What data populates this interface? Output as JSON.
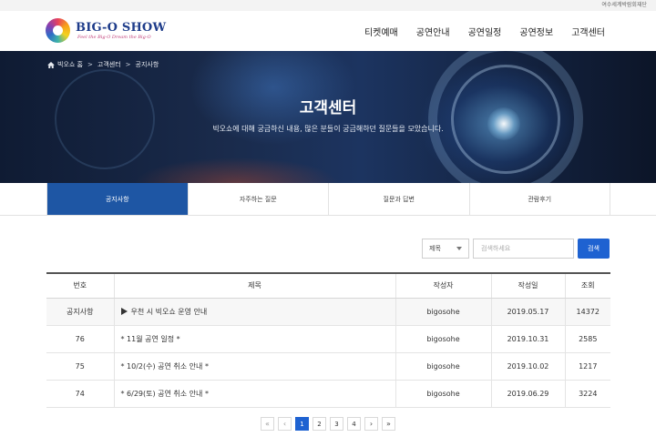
{
  "topbar": {
    "org": "여수세계박람회재단"
  },
  "logo": {
    "title": "BIG-O SHOW",
    "subtitle": "Feel the Big-O  Dream the Big-O"
  },
  "nav": {
    "items": [
      "티켓예매",
      "공연안내",
      "공연일정",
      "공연정보",
      "고객센터"
    ]
  },
  "breadcrumb": {
    "home": "빅오쇼 홈",
    "level1": "고객센터",
    "level2": "공지사항",
    "sep": ">"
  },
  "hero": {
    "title": "고객센터",
    "description": "빅오쇼에 대해 궁금하신 내용, 많은 분들이 궁금해하던 질문들을 모았습니다."
  },
  "tabs": [
    {
      "label": "공지사항",
      "active": true
    },
    {
      "label": "자주하는 질문",
      "active": false
    },
    {
      "label": "질문과 답변",
      "active": false
    },
    {
      "label": "관람후기",
      "active": false
    }
  ],
  "search": {
    "field": "제목",
    "placeholder": "검색하세요",
    "button": "검색"
  },
  "table": {
    "headers": [
      "번호",
      "제목",
      "작성자",
      "작성일",
      "조회"
    ],
    "rows": [
      {
        "no": "공지사항",
        "title": "우천 시 빅오쇼 운영 안내",
        "author": "bigosohe",
        "date": "2019.05.17",
        "views": "14372"
      },
      {
        "no": "76",
        "title": "* 11월 공연 일정 *",
        "author": "bigosohe",
        "date": "2019.10.31",
        "views": "2585"
      },
      {
        "no": "75",
        "title": "* 10/2(수) 공연 취소 안내 *",
        "author": "bigosohe",
        "date": "2019.10.02",
        "views": "1217"
      },
      {
        "no": "74",
        "title": "* 6/29(토) 공연 취소 안내 *",
        "author": "bigosohe",
        "date": "2019.06.29",
        "views": "3224"
      }
    ]
  },
  "pager": {
    "first": "«",
    "prev": "‹",
    "pages": [
      "1",
      "2",
      "3",
      "4"
    ],
    "next": "›",
    "last": "»",
    "current": "1"
  },
  "colors": {
    "primary": "#1e56a4",
    "button": "#1e62d1",
    "brand_text": "#1e3c8a"
  }
}
